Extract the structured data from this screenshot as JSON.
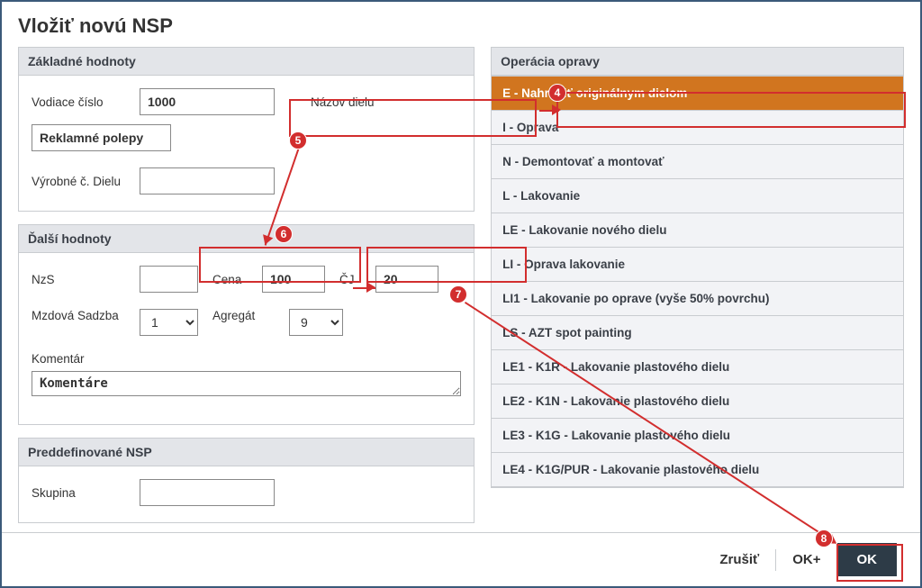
{
  "dialog": {
    "title": "Vložiť novú NSP"
  },
  "panels": {
    "basic": {
      "header": "Základné hodnoty",
      "vodiace_cislo_label": "Vodiace číslo",
      "vodiace_cislo_value": "1000",
      "nazov_dielu_label": "Názov dielu",
      "nazov_dielu_value": "Reklamné polepy",
      "vyrobne_c_dielu_label": "Výrobné č. Dielu",
      "vyrobne_c_dielu_value": ""
    },
    "further": {
      "header": "Ďalší hodnoty",
      "nzs_label": "NzS",
      "nzs_value": "",
      "cena_label": "Cena",
      "cena_value": "100",
      "cj_label": "ČJ",
      "cj_value": "20",
      "mzdova_label": "Mzdová Sadzba",
      "mzdova_value": "1",
      "agregat_label": "Agregát",
      "agregat_value": "9",
      "komentar_label": "Komentár",
      "komentar_value": "Komentáre"
    },
    "preddef": {
      "header": "Preddefinované NSP",
      "skupina_label": "Skupina",
      "skupina_value": ""
    },
    "operations": {
      "header": "Operácia opravy",
      "items": [
        {
          "label": "E - Nahradiť originálnym dielom",
          "selected": true
        },
        {
          "label": "I - Oprava",
          "selected": false
        },
        {
          "label": "N - Demontovať a montovať",
          "selected": false
        },
        {
          "label": "L - Lakovanie",
          "selected": false
        },
        {
          "label": "LE - Lakovanie nového dielu",
          "selected": false
        },
        {
          "label": "LI - Oprava lakovanie",
          "selected": false
        },
        {
          "label": "LI1 - Lakovanie po oprave (vyše 50% povrchu)",
          "selected": false
        },
        {
          "label": "LS - AZT spot painting",
          "selected": false
        },
        {
          "label": "LE1 - K1R - Lakovanie plastového dielu",
          "selected": false
        },
        {
          "label": "LE2 - K1N - Lakovanie plastového dielu",
          "selected": false
        },
        {
          "label": "LE3 - K1G - Lakovanie plastového dielu",
          "selected": false
        },
        {
          "label": "LE4 - K1G/PUR - Lakovanie plastového dielu",
          "selected": false
        }
      ]
    }
  },
  "footer": {
    "cancel": "Zrušiť",
    "ok_plus": "OK+",
    "ok": "OK"
  },
  "annotations": {
    "m4": "4",
    "m5": "5",
    "m6": "6",
    "m7": "7",
    "m8": "8"
  }
}
